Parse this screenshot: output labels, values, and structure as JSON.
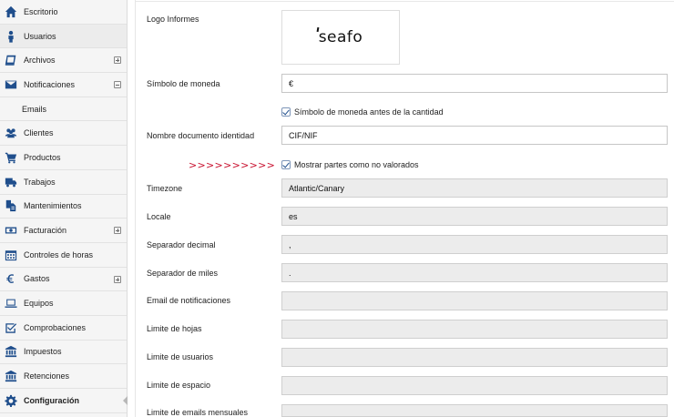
{
  "sidebar": {
    "items": [
      {
        "label": "Escritorio",
        "icon": "home-icon"
      },
      {
        "label": "Usuarios",
        "icon": "user-icon"
      },
      {
        "label": "Archivos",
        "icon": "book-icon"
      },
      {
        "label": "Notificaciones",
        "icon": "envelope-icon"
      },
      {
        "label": "Emails"
      },
      {
        "label": "Clientes",
        "icon": "users-icon"
      },
      {
        "label": "Productos",
        "icon": "cart-icon"
      },
      {
        "label": "Trabajos",
        "icon": "truck-icon"
      },
      {
        "label": "Mantenimientos",
        "icon": "documents-icon"
      },
      {
        "label": "Facturación",
        "icon": "money-icon"
      },
      {
        "label": "Controles de horas",
        "icon": "calendar-icon"
      },
      {
        "label": "Gastos",
        "icon": "euro-icon"
      },
      {
        "label": "Equipos",
        "icon": "laptop-icon"
      },
      {
        "label": "Comprobaciones",
        "icon": "checkbox-icon"
      },
      {
        "label": "Impuestos",
        "icon": "bank-icon"
      },
      {
        "label": "Retenciones",
        "icon": "bank-icon"
      },
      {
        "label": "Configuración",
        "icon": "gear-icon"
      }
    ]
  },
  "form": {
    "logo_label": "Logo Informes",
    "logo_text": "seafo",
    "currency_label": "Símbolo de moneda",
    "currency_value": "€",
    "currency_before_label": "Símbolo de moneda antes de la cantidad",
    "id_doc_label": "Nombre documento identidad",
    "id_doc_value": "CIF/NIF",
    "arrows": ">>>>>>>>>>",
    "show_unvalued_label": "Mostrar partes como no valorados",
    "timezone_label": "Timezone",
    "timezone_value": "Atlantic/Canary",
    "locale_label": "Locale",
    "locale_value": "es",
    "decimal_sep_label": "Separador decimal",
    "decimal_sep_value": ",",
    "thousands_sep_label": "Separador de miles",
    "thousands_sep_value": ".",
    "notif_email_label": "Email de notificaciones",
    "notif_email_value": "",
    "sheet_limit_label": "Limite de hojas",
    "sheet_limit_value": "",
    "user_limit_label": "Limite de usuarios",
    "user_limit_value": "",
    "space_limit_label": "Limite de espacio",
    "space_limit_value": "",
    "email_limit_label": "Limite de emails mensuales",
    "email_limit_value": ""
  }
}
